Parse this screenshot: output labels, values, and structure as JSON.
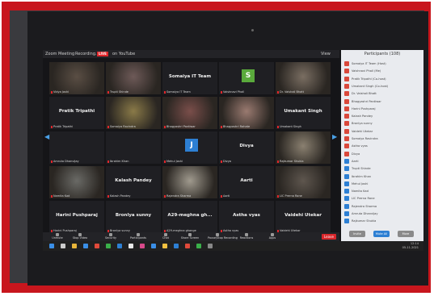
{
  "window": {
    "app": "Zoom Meeting",
    "recording": "Recording...",
    "live_badge": "LIVE",
    "live_on": "on YouTube",
    "view_label": "View"
  },
  "tiles": [
    {
      "name": "",
      "label": "Vidya Joshi",
      "type": "video",
      "color": "#5a4e44"
    },
    {
      "name": "",
      "label": "Trupti Shinde",
      "type": "video",
      "color": "#6e5a58"
    },
    {
      "name": "Somaiya IT Team",
      "label": "Somaiya IT Team",
      "type": "name"
    },
    {
      "name": "",
      "label": "Vaishnavi Phall",
      "type": "avatar",
      "avatar": "S",
      "avatar_color": "#5aaa3c"
    },
    {
      "name": "",
      "label": "Dr. Vaishali Bhatt",
      "type": "video",
      "color": "#7a6e62"
    },
    {
      "name": "Pratik Tripathi",
      "label": "Pratik Tripathi",
      "type": "name"
    },
    {
      "name": "",
      "label": "Somaiya Ravindra",
      "type": "video",
      "color": "#8a7a48",
      "highlight": true
    },
    {
      "name": "",
      "label": "Bhagyashri Pantiwar",
      "type": "video",
      "color": "#7a4e4a"
    },
    {
      "name": "",
      "label": "Bhagyashri Rahate",
      "type": "video",
      "color": "#9a7a70"
    },
    {
      "name": "Umakant Singh",
      "label": "Umakant Singh",
      "type": "name"
    },
    {
      "name": "",
      "label": "Amruta Dhanvijay",
      "type": "name"
    },
    {
      "name": "",
      "label": "Ibrahim Khan",
      "type": "name"
    },
    {
      "name": "",
      "label": "Mehul Joshi",
      "type": "avatar",
      "avatar": "J",
      "avatar_color": "#2d7fd3"
    },
    {
      "name": "Divya",
      "label": "Divya",
      "type": "name"
    },
    {
      "name": "",
      "label": "Rajkumar Shukla",
      "type": "video",
      "color": "#8a8070"
    },
    {
      "name": "",
      "label": "Namita Kad",
      "type": "video",
      "color": "#6a6a66"
    },
    {
      "name": "Kalash Pandey",
      "label": "Kalash Pandey",
      "type": "name"
    },
    {
      "name": "",
      "label": "Rajendra Sharma",
      "type": "video",
      "color": "#a09a8e"
    },
    {
      "name": "Aarti",
      "label": "Aarti",
      "type": "name"
    },
    {
      "name": "",
      "label": "LIC Prerna Rane",
      "type": "video",
      "color": "#5e564e"
    },
    {
      "name": "Harini Pushparaj",
      "label": "Harini Pushparaj",
      "type": "name"
    },
    {
      "name": "Bronlya sunny",
      "label": "Bronlya sunny",
      "type": "name"
    },
    {
      "name": "A29-meghna gh...",
      "label": "A29-meghna ghange",
      "type": "name"
    },
    {
      "name": "Astha vyas",
      "label": "Astha vyas",
      "type": "name"
    },
    {
      "name": "Vaidehi Utekar",
      "label": "Vaidehi Utekar",
      "type": "name"
    }
  ],
  "toolbar": {
    "items": [
      "Unmute",
      "Stop Video",
      "Security",
      "Participants",
      "Chat",
      "Share Screen",
      "Pause/Stop Recording",
      "Reactions",
      "Apps"
    ],
    "leave": "Leave"
  },
  "participants_panel": {
    "title": "Participants (108)",
    "rows": [
      {
        "name": "Somaiya IT Team (Host)",
        "color": "#d9483b"
      },
      {
        "name": "Vaishnavi Phall (Me)",
        "color": "#d9483b"
      },
      {
        "name": "Pratik Tripathi (Co-host)",
        "color": "#d9483b"
      },
      {
        "name": "Umakant Singh (Co-host)",
        "color": "#d9483b"
      },
      {
        "name": "Dr. Vaishali Bhatt",
        "color": "#d9483b"
      },
      {
        "name": "Bhagyashri Pantiwar",
        "color": "#d9483b"
      },
      {
        "name": "Harini Pushparaj",
        "color": "#d9483b"
      },
      {
        "name": "Kalash Pandey",
        "color": "#d9483b"
      },
      {
        "name": "Bronlya sunny",
        "color": "#d9483b"
      },
      {
        "name": "Vaidehi Utekar",
        "color": "#d9483b"
      },
      {
        "name": "Somaiya Ravindra",
        "color": "#d9483b"
      },
      {
        "name": "Astha vyas",
        "color": "#d9483b"
      },
      {
        "name": "Divya",
        "color": "#d9483b"
      },
      {
        "name": "Aarti",
        "color": "#2d7fd3"
      },
      {
        "name": "Trupti Shinde",
        "color": "#2d7fd3"
      },
      {
        "name": "Ibrahim Khan",
        "color": "#2d7fd3"
      },
      {
        "name": "Mehul Joshi",
        "color": "#2d7fd3"
      },
      {
        "name": "Namita Kad",
        "color": "#2d7fd3"
      },
      {
        "name": "LIC Prerna Rane",
        "color": "#2d7fd3"
      },
      {
        "name": "Rajendra Sharma",
        "color": "#2d7fd3"
      },
      {
        "name": "Amruta Dhanvijay",
        "color": "#2d7fd3"
      },
      {
        "name": "Rajkumar Shukla",
        "color": "#2d7fd3"
      }
    ],
    "invite": "Invite",
    "mute_all": "Mute All",
    "more": "More"
  },
  "taskbar": {
    "clock": "12:14",
    "date": "05-11-2021"
  }
}
